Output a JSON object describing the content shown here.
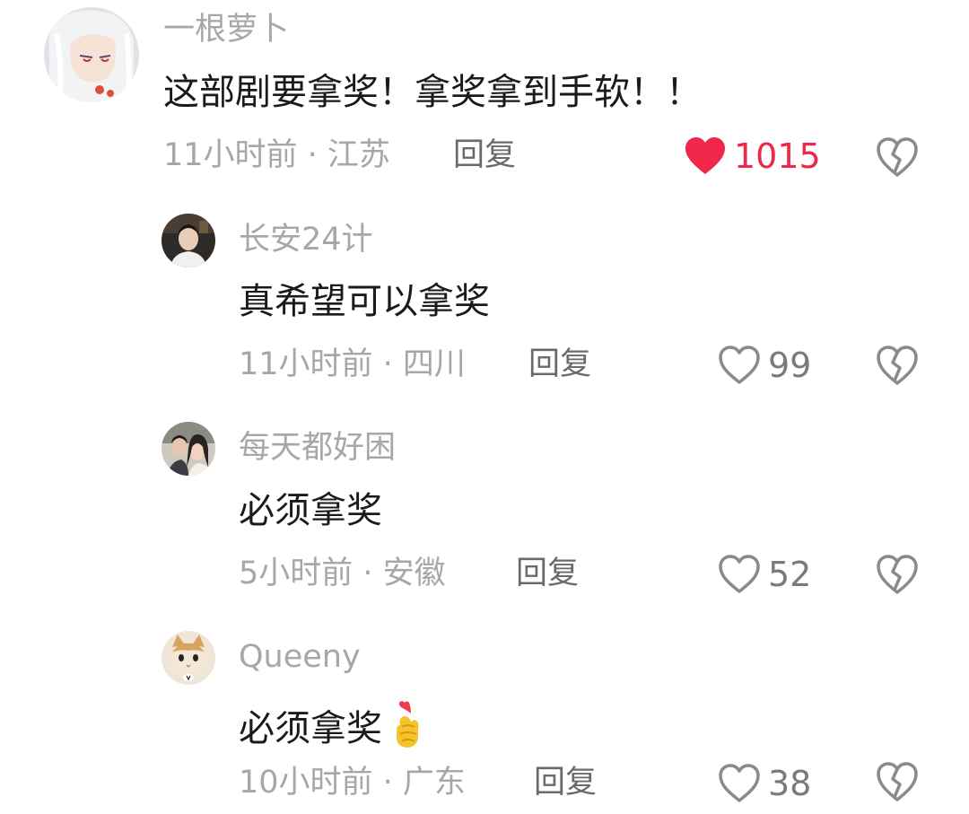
{
  "colors": {
    "liked_heart": "#f0264a",
    "liked_count": "#f0264a",
    "muted_text": "#a7a7a7",
    "reply_text": "#6a6a6a",
    "body_text": "#1a1a1a",
    "icon_stroke": "#8a8a8a"
  },
  "comments": [
    {
      "username": "一根萝卜",
      "text": "这部剧要拿奖！拿奖拿到手软！！",
      "meta": "11小时前 · 江苏",
      "reply_label": "回复",
      "like_count": "1015",
      "liked": true,
      "avatar_icon": "anime-character-avatar"
    },
    {
      "username": "长安24计",
      "text": "真希望可以拿奖",
      "meta": "11小时前 · 四川",
      "reply_label": "回复",
      "like_count": "99",
      "liked": false,
      "avatar_icon": "person-avatar"
    },
    {
      "username": "每天都好困",
      "text": "必须拿奖",
      "meta": "5小时前 · 安徽",
      "reply_label": "回复",
      "like_count": "52",
      "liked": false,
      "avatar_icon": "couple-photo-avatar"
    },
    {
      "username": "Queeny",
      "text": "必须拿奖",
      "emoji": "finger-heart-emoji",
      "meta": "10小时前 · 广东",
      "reply_label": "回复",
      "like_count": "38",
      "liked": false,
      "avatar_icon": "cat-avatar"
    }
  ]
}
